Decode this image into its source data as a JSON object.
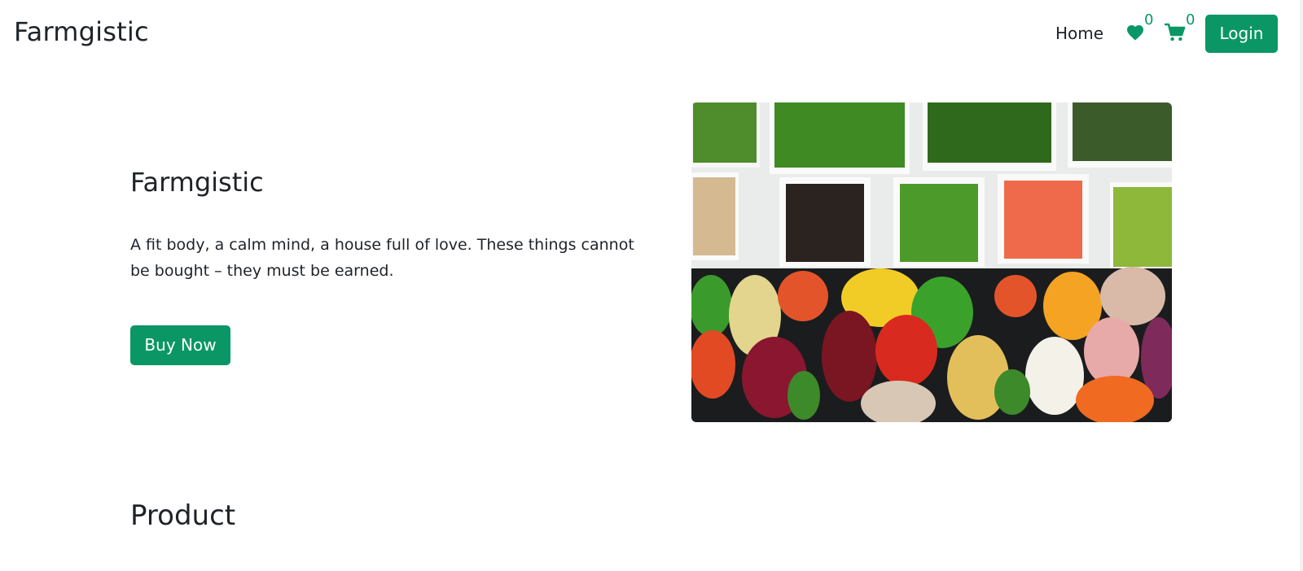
{
  "navbar": {
    "brand": "Farmgistic",
    "home_label": "Home",
    "wishlist_count": "0",
    "cart_count": "0",
    "login_label": "Login"
  },
  "hero": {
    "title": "Farmgistic",
    "text": "A fit body, a calm mind, a house full of love. These things cannot be bought – they must be earned.",
    "button_label": "Buy Now"
  },
  "products": {
    "title": "Product"
  },
  "colors": {
    "accent": "#0a9765",
    "text": "#1f2328",
    "background": "#ffffff"
  },
  "icons": {
    "wishlist": "heart-icon",
    "cart": "cart-icon"
  }
}
